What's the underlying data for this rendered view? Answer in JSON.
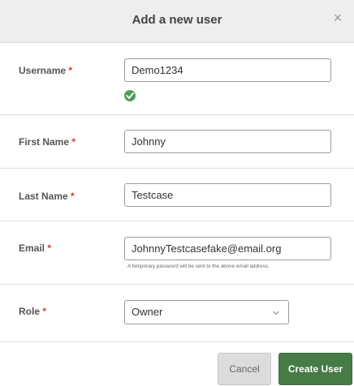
{
  "dialog": {
    "title": "Add a new user",
    "close_glyph": "×"
  },
  "required_marker": "*",
  "fields": {
    "username": {
      "label": "Username",
      "value": "Demo1234",
      "valid_icon": "check-circle-icon"
    },
    "first_name": {
      "label": "First Name",
      "value": "Johnny"
    },
    "last_name": {
      "label": "Last Name",
      "value": "Testcase"
    },
    "email": {
      "label": "Email",
      "value": "JohnnyTestcasefake@email.org",
      "hint": "A temporary password will be sent to the above email address."
    },
    "role": {
      "label": "Role",
      "selected": "Owner",
      "dropdown_icon": "chevron-down-icon"
    }
  },
  "actions": {
    "cancel_label": "Cancel",
    "create_label": "Create User"
  },
  "colors": {
    "header_bg": "#eeeeee",
    "required": "#d9363e",
    "valid": "#4f9d5b",
    "primary_button": "#467b46",
    "secondary_button": "#dcdcdc"
  }
}
